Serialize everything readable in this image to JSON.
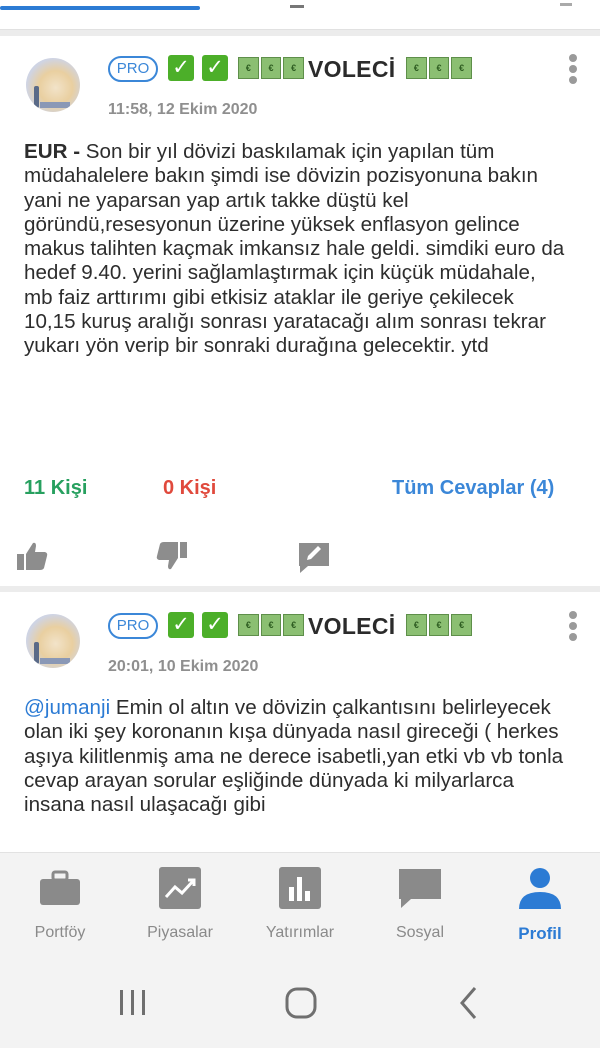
{
  "posts": [
    {
      "pro_label": "PRO",
      "username": "VOLECİ",
      "timestamp": "11:58, 12 Ekim 2020",
      "body_prefix": "EUR -",
      "body": " Son bir yıl dövizi baskılamak için yapılan tüm müdahalelere bakın şimdi ise dövizin pozisyonuna bakın yani ne yaparsan yap artık takke düştü kel göründü,resesyonun üzerine yüksek enflasyon gelince makus talihten kaçmak imkansız hale geldi. simdiki euro da hedef 9.40. yerini sağlamlaştırmak için küçük müdahale, mb faiz arttırımı gibi etkisiz ataklar ile geriye çekilecek 10,15 kuruş aralığı sonrası yaratacağı alım sonrası tekrar yukarı yön verip bir sonraki durağına gelecektir. ytd",
      "likes": "11 Kişi",
      "dislikes": "0 Kişi",
      "replies": "Tüm Cevaplar (4)"
    },
    {
      "pro_label": "PRO",
      "username": "VOLECİ",
      "timestamp": "20:01, 10 Ekim 2020",
      "mention": "@jumanji",
      "body": " Emin ol altın ve dövizin çalkantısını belirleyecek olan iki şey koronanın kışa dünyada nasıl gireceği ( herkes aşıya kilitlenmiş ama ne derece isabetli,yan etki vb vb tonla cevap arayan sorular eşliğinde dünyada ki milyarlarca insana nasıl ulaşacağı gibi"
    }
  ],
  "money_glyph": "€",
  "nav": [
    {
      "label": "Portföy",
      "icon": "briefcase-icon",
      "active": false
    },
    {
      "label": "Piyasalar",
      "icon": "trend-chart-icon",
      "active": false
    },
    {
      "label": "Yatırımlar",
      "icon": "bar-chart-icon",
      "active": false
    },
    {
      "label": "Sosyal",
      "icon": "chat-bubble-icon",
      "active": false
    },
    {
      "label": "Profil",
      "icon": "person-icon",
      "active": true
    }
  ],
  "colors": {
    "accent": "#2c7bd4",
    "likes": "#27a05f",
    "dislikes": "#e0493c",
    "check": "#4caf29"
  }
}
